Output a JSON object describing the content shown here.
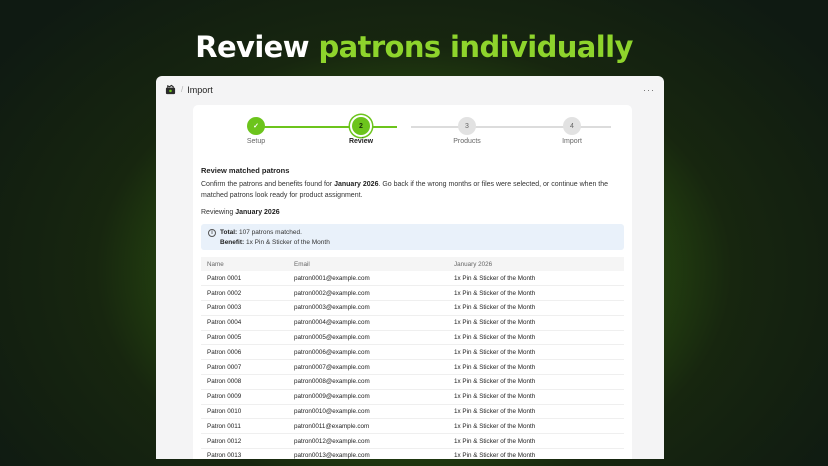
{
  "headline": {
    "part1": "Review",
    "part2": "patrons individually"
  },
  "window": {
    "title": "Import",
    "more_label": "···"
  },
  "stepper": {
    "steps": [
      {
        "number": "✓",
        "label": "Setup",
        "state": "done"
      },
      {
        "number": "2",
        "label": "Review",
        "state": "current"
      },
      {
        "number": "3",
        "label": "Products",
        "state": "todo"
      },
      {
        "number": "4",
        "label": "Import",
        "state": "todo"
      }
    ]
  },
  "review": {
    "title": "Review matched patrons",
    "description_before": "Confirm the patrons and benefits found for ",
    "description_bold": "January 2026",
    "description_after": ". Go back if the wrong months or files were selected, or continue when the matched patrons look ready for product assignment.",
    "reviewing_label": "Reviewing",
    "reviewing_month": "January 2026"
  },
  "summary": {
    "icon": "info-icon",
    "total_label": "Total:",
    "total_value": "107 patrons matched.",
    "benefit_label": "Benefit:",
    "benefit_value": "1x Pin & Sticker of the Month"
  },
  "table": {
    "headers": [
      "Name",
      "Email",
      "January 2026"
    ],
    "rows": [
      [
        "Patron 0001",
        "patron0001@example.com",
        "1x Pin & Sticker of the Month"
      ],
      [
        "Patron 0002",
        "patron0002@example.com",
        "1x Pin & Sticker of the Month"
      ],
      [
        "Patron 0003",
        "patron0003@example.com",
        "1x Pin & Sticker of the Month"
      ],
      [
        "Patron 0004",
        "patron0004@example.com",
        "1x Pin & Sticker of the Month"
      ],
      [
        "Patron 0005",
        "patron0005@example.com",
        "1x Pin & Sticker of the Month"
      ],
      [
        "Patron 0006",
        "patron0006@example.com",
        "1x Pin & Sticker of the Month"
      ],
      [
        "Patron 0007",
        "patron0007@example.com",
        "1x Pin & Sticker of the Month"
      ],
      [
        "Patron 0008",
        "patron0008@example.com",
        "1x Pin & Sticker of the Month"
      ],
      [
        "Patron 0009",
        "patron0009@example.com",
        "1x Pin & Sticker of the Month"
      ],
      [
        "Patron 0010",
        "patron0010@example.com",
        "1x Pin & Sticker of the Month"
      ],
      [
        "Patron 0011",
        "patron0011@example.com",
        "1x Pin & Sticker of the Month"
      ],
      [
        "Patron 0012",
        "patron0012@example.com",
        "1x Pin & Sticker of the Month"
      ],
      [
        "Patron 0013",
        "patron0013@example.com",
        "1x Pin & Sticker of the Month"
      ]
    ]
  },
  "colors": {
    "accent": "#6cc41c",
    "headline_accent": "#8ed42c",
    "info_bg": "#e9f1fa"
  }
}
